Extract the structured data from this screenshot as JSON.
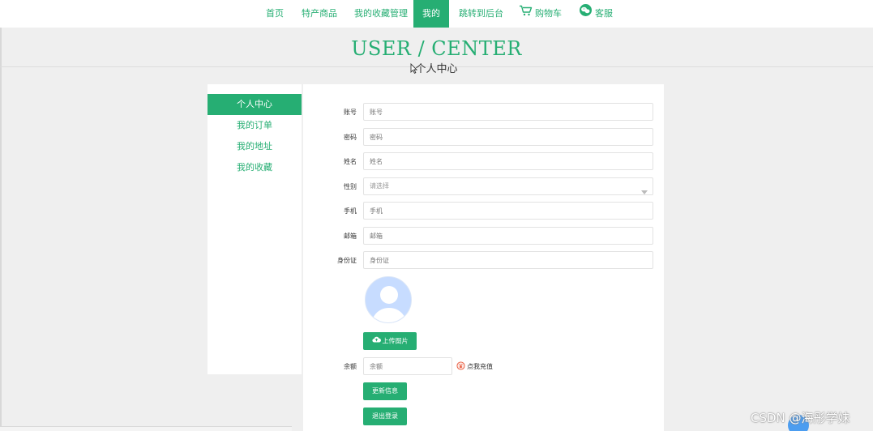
{
  "nav": {
    "items": [
      {
        "label": "首页",
        "active": false
      },
      {
        "label": "特产商品",
        "active": false
      },
      {
        "label": "我的收藏管理",
        "active": false
      },
      {
        "label": "我的",
        "active": true
      },
      {
        "label": "跳转到后台",
        "active": false
      },
      {
        "label": "购物车",
        "icon": "cart-icon",
        "active": false
      },
      {
        "label": "客服",
        "icon": "wechat-icon",
        "active": false
      }
    ]
  },
  "header": {
    "title": "USER / CENTER",
    "subtitle": "个人中心"
  },
  "sidebar": {
    "items": [
      {
        "label": "个人中心",
        "active": true
      },
      {
        "label": "我的订单",
        "active": false
      },
      {
        "label": "我的地址",
        "active": false
      },
      {
        "label": "我的收藏",
        "active": false
      }
    ]
  },
  "form": {
    "fields": [
      {
        "label": "账号",
        "placeholder": "账号"
      },
      {
        "label": "密码",
        "placeholder": "密码"
      },
      {
        "label": "姓名",
        "placeholder": "姓名"
      },
      {
        "label": "性别",
        "placeholder": "请选择",
        "type": "select"
      },
      {
        "label": "手机",
        "placeholder": "手机"
      },
      {
        "label": "邮箱",
        "placeholder": "邮箱"
      },
      {
        "label": "身份证",
        "placeholder": "身份证"
      }
    ],
    "upload_label": "上传图片",
    "balance_label": "余额",
    "balance_placeholder": "余额",
    "recharge_label": "点我充值",
    "update_label": "更新信息",
    "logout_label": "退出登录"
  },
  "colors": {
    "accent": "#26ae73",
    "background": "#efefef"
  },
  "watermark": "CSDN @海彤学妹"
}
